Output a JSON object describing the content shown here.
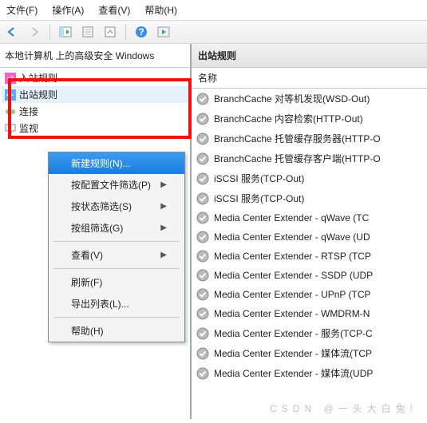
{
  "menubar": {
    "file": "文件(F)",
    "action": "操作(A)",
    "view": "查看(V)",
    "help": "帮助(H)"
  },
  "tree": {
    "header": "本地计算机 上的高级安全 Windows",
    "inbound": "入站规则",
    "outbound": "出站规则",
    "connection": "连接",
    "monitor": "监视"
  },
  "context": {
    "new_rule": "新建规则(N)...",
    "by_profile": "按配置文件筛选(P)",
    "by_state": "按状态筛选(S)",
    "by_group": "按组筛选(G)",
    "view": "查看(V)",
    "refresh": "刷新(F)",
    "export": "导出列表(L)...",
    "help": "帮助(H)"
  },
  "list": {
    "title": "出站规则",
    "column": "名称",
    "rows": [
      "BranchCache 对等机发现(WSD-Out)",
      "BranchCache 内容检索(HTTP-Out)",
      "BranchCache 托管缓存服务器(HTTP-O",
      "BranchCache 托管缓存客户端(HTTP-O",
      "iSCSI 服务(TCP-Out)",
      "iSCSI 服务(TCP-Out)",
      "Media Center Extender - qWave (TC",
      "Media Center Extender - qWave (UD",
      "Media Center Extender - RTSP (TCP",
      "Media Center Extender - SSDP (UDP",
      "Media Center Extender - UPnP (TCP",
      "Media Center Extender - WMDRM-N",
      "Media Center Extender - 服务(TCP-C",
      "Media Center Extender - 媒体流(TCP",
      "Media Center Extender - 媒体流(UDP"
    ]
  },
  "watermark": "CSDN @一头大白兔!"
}
